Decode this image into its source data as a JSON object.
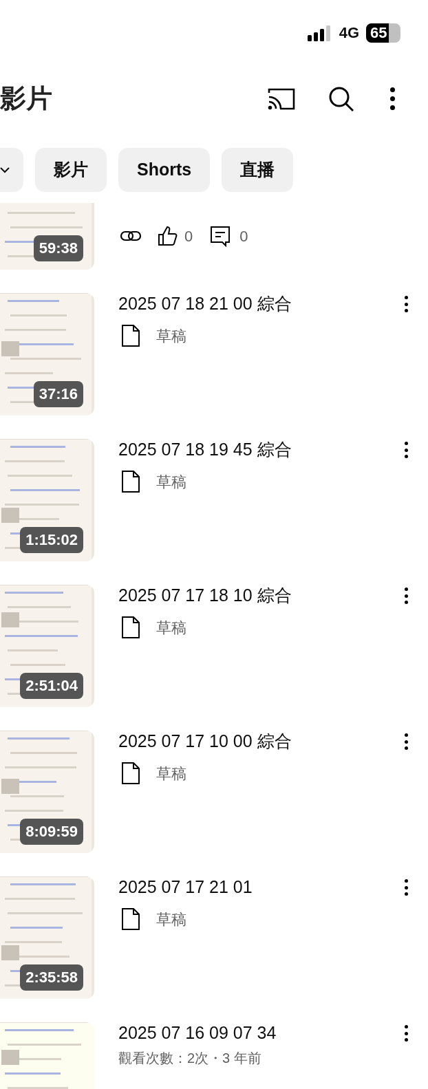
{
  "status_bar": {
    "network": "4G",
    "battery": "65"
  },
  "header": {
    "title": "影片"
  },
  "chips": [
    {
      "kind": "dropdown",
      "selected": false
    },
    {
      "kind": "text",
      "label": "影片",
      "selected": false
    },
    {
      "kind": "text",
      "label": "Shorts",
      "selected": false
    },
    {
      "kind": "text",
      "label": "直播",
      "selected": false
    }
  ],
  "videos": [
    {
      "kind": "published",
      "duration": "59:38",
      "likes": "0",
      "comments": "0"
    },
    {
      "kind": "draft",
      "title": "2025 07 18 21 00 綜合",
      "status": "草稿",
      "duration": "37:16"
    },
    {
      "kind": "draft",
      "title": "2025 07 18 19 45 綜合",
      "status": "草稿",
      "duration": "1:15:02"
    },
    {
      "kind": "draft",
      "title": "2025 07 17 18 10 綜合",
      "status": "草稿",
      "duration": "2:51:04"
    },
    {
      "kind": "draft",
      "title": "2025 07 17 10 00 綜合",
      "status": "草稿",
      "duration": "8:09:59"
    },
    {
      "kind": "draft",
      "title": "2025 07 17 21 01",
      "status": "草稿",
      "duration": "2:35:58"
    },
    {
      "kind": "published",
      "title": "2025 07 16 09 07 34",
      "meta": "觀看次數：2次・3 年前"
    }
  ]
}
